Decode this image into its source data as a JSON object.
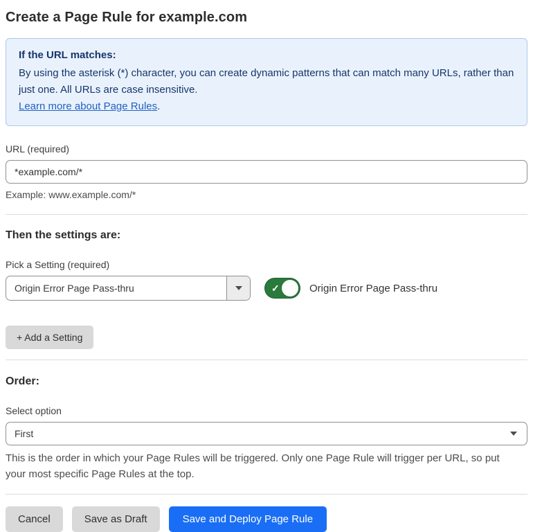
{
  "page": {
    "title": "Create a Page Rule for example.com"
  },
  "colors": {
    "info_box_background": "#e9f2fc",
    "info_box_border": "#abc9ec",
    "info_text": "#17356b",
    "link_blue": "#2160c4",
    "toggle_on_green": "#297a3b",
    "primary_button_blue": "#1a6ef5",
    "secondary_button_gray": "#d9d9d9"
  },
  "info_box": {
    "heading": "If the URL matches:",
    "body": "By using the asterisk (*) character, you can create dynamic patterns that can match many URLs, rather than just one. All URLs are case insensitive.",
    "link_label": "Learn more about Page Rules",
    "link_suffix": "."
  },
  "url_section": {
    "label": "URL (required)",
    "value": "*example.com/*",
    "example": "Example: www.example.com/*"
  },
  "settings_section": {
    "heading": "Then the settings are:",
    "pick_label": "Pick a Setting (required)",
    "selected_setting": "Origin Error Page Pass-thru",
    "toggle_state": "on",
    "toggle_check_icon": "✓",
    "toggle_label": "Origin Error Page Pass-thru",
    "add_setting_label": "+ Add a Setting"
  },
  "order_section": {
    "heading": "Order:",
    "select_label": "Select option",
    "selected_option": "First",
    "help_text": "This is the order in which your Page Rules will be triggered. Only one Page Rule will trigger per URL, so put your most specific Page Rules at the top."
  },
  "footer": {
    "cancel_label": "Cancel",
    "save_draft_label": "Save as Draft",
    "save_deploy_label": "Save and Deploy Page Rule"
  }
}
